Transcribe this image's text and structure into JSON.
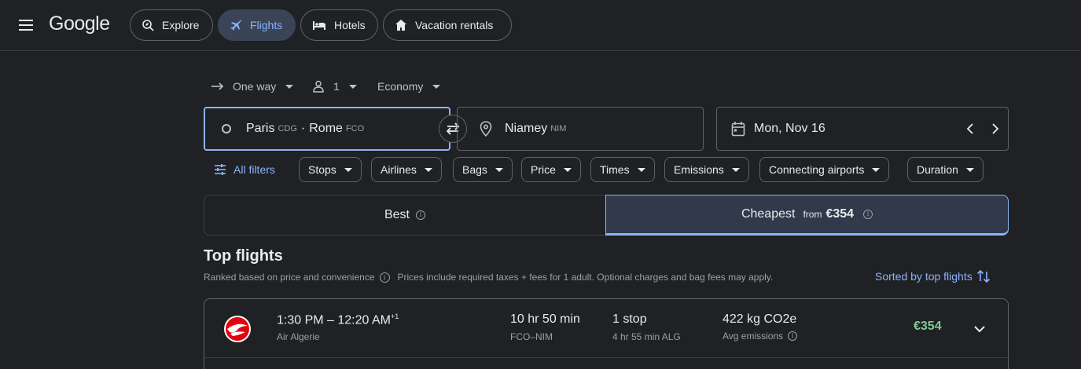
{
  "header": {
    "logo": "Google",
    "nav": [
      {
        "label": "Explore",
        "icon": "explore-icon"
      },
      {
        "label": "Flights",
        "icon": "airplane-icon",
        "active": true
      },
      {
        "label": "Hotels",
        "icon": "bed-icon"
      },
      {
        "label": "Vacation rentals",
        "icon": "house-icon"
      }
    ]
  },
  "trip": {
    "type": "One way",
    "passengers": "1",
    "cabin": "Economy"
  },
  "search": {
    "origin_city1": "Paris",
    "origin_code1": "CDG",
    "origin_sep": "·",
    "origin_city2": "Rome",
    "origin_code2": "FCO",
    "destination_city": "Niamey",
    "destination_code": "NIM",
    "date": "Mon, Nov 16"
  },
  "filters": {
    "all_filters": "All filters",
    "chips": [
      "Stops",
      "Airlines",
      "Bags",
      "Price",
      "Times",
      "Emissions",
      "Connecting airports",
      "Duration"
    ]
  },
  "sort_tabs": {
    "best": "Best",
    "cheapest": "Cheapest",
    "from_label": "from",
    "cheapest_price": "€354"
  },
  "results": {
    "title": "Top flights",
    "ranked_note": "Ranked based on price and convenience",
    "price_note": "Prices include required taxes + fees for 1 adult. Optional charges and bag fees may apply.",
    "sorted_label": "Sorted by top flights",
    "flights": [
      {
        "times": "1:30 PM – 12:20 AM",
        "day_offset": "+1",
        "airline": "Air Algerie",
        "duration": "10 hr 50 min",
        "route": "FCO–NIM",
        "stops": "1 stop",
        "layover": "4 hr 55 min ALG",
        "emissions": "422 kg CO2e",
        "emissions_note": "Avg emissions",
        "price": "€354"
      }
    ]
  },
  "colors": {
    "background": "#202124",
    "accent": "#8ab4f8",
    "price": "#81c995",
    "active_pill": "#394457"
  }
}
